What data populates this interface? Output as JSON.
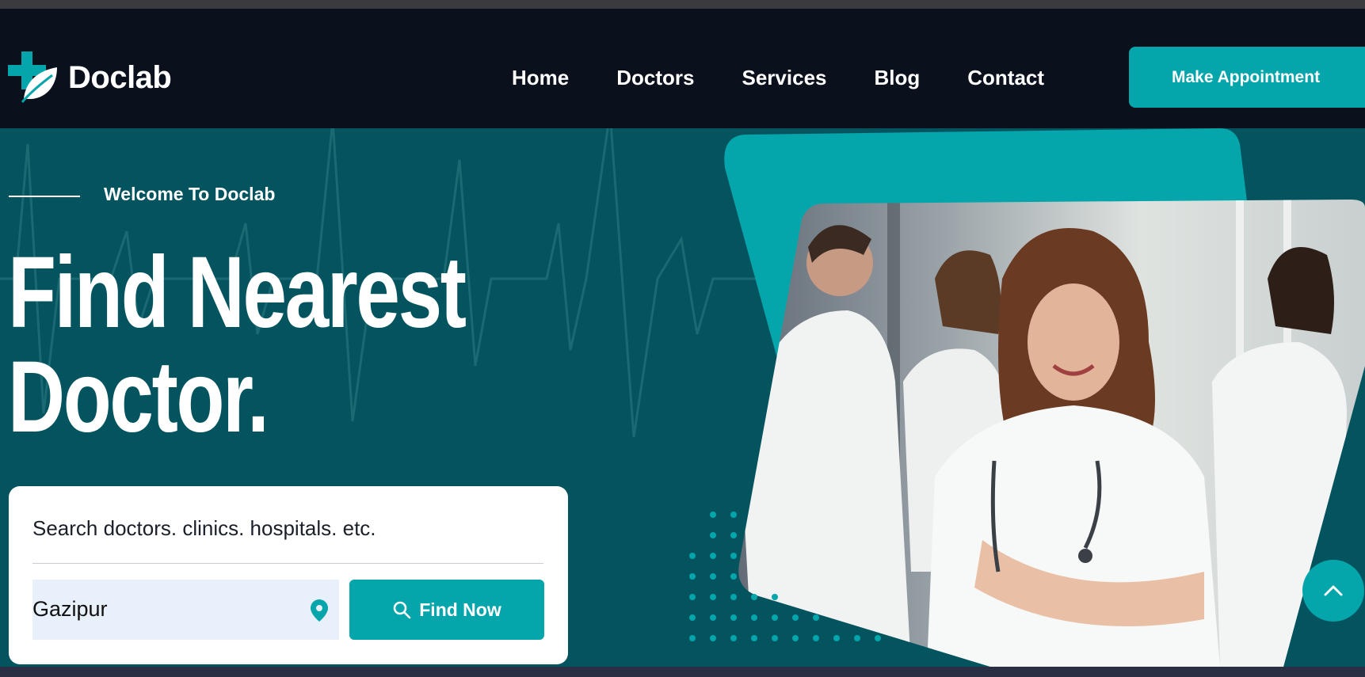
{
  "brand": {
    "name": "Doclab",
    "logo_icon": "medical-cross-leaf-icon",
    "colors": {
      "accent": "#04a5ab",
      "hero_bg": "#03545f",
      "nav_bg": "#0b101d"
    }
  },
  "nav": {
    "items": [
      {
        "label": "Home"
      },
      {
        "label": "Doctors"
      },
      {
        "label": "Services"
      },
      {
        "label": "Blog"
      },
      {
        "label": "Contact"
      }
    ],
    "cta_label": "Make Appointment"
  },
  "hero": {
    "kicker": "Welcome To Doclab",
    "title_line1": "Find Nearest",
    "title_line2": "Doctor."
  },
  "search": {
    "label": "Search doctors. clinics. hospitals. etc.",
    "location_value": "Gazipur",
    "location_icon": "map-pin-icon",
    "button_label": "Find Now",
    "button_icon": "search-icon"
  },
  "scroll_top_icon": "chevron-up-icon"
}
